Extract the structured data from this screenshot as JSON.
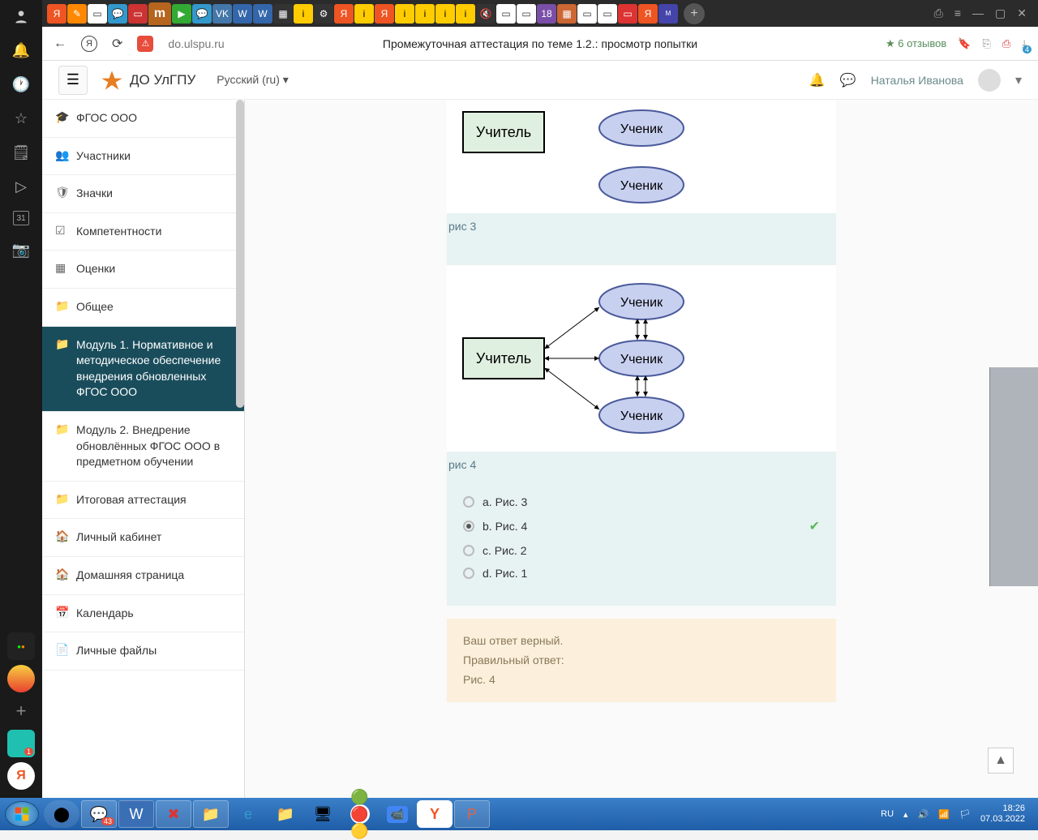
{
  "os_sidebar": {
    "icons": [
      "user",
      "bell",
      "clock",
      "star",
      "note",
      "play",
      "calendar",
      "camera"
    ]
  },
  "tabstrip": {
    "active": "m"
  },
  "addr": {
    "url": "do.ulspu.ru",
    "title": "Промежуточная аттестация по теме 1.2.: просмотр попытки",
    "reviews": "★ 6 отзывов",
    "download_badge": "4"
  },
  "moodle": {
    "brand": "ДО УлГПУ",
    "lang": "Русский (ru) ▾",
    "user": "Наталья Иванова"
  },
  "nav": [
    {
      "icon": "🎓",
      "label": "ФГОС ООО"
    },
    {
      "icon": "👥",
      "label": "Участники"
    },
    {
      "icon": "🛡",
      "label": "Значки"
    },
    {
      "icon": "☑",
      "label": "Компетентности"
    },
    {
      "icon": "▦",
      "label": "Оценки"
    },
    {
      "icon": "📁",
      "label": "Общее"
    },
    {
      "icon": "📁",
      "label": "Модуль 1. Нормативное и методическое обеспечение внедрения обновленных ФГОС ООО",
      "active": true
    },
    {
      "icon": "📁",
      "label": "Модуль 2. Внедрение обновлённых ФГОС ООО в предметном обучении"
    },
    {
      "icon": "📁",
      "label": "Итоговая аттестация"
    },
    {
      "icon": "🏠",
      "label": "Личный кабинет"
    },
    {
      "icon": "🏠",
      "label": "Домашняя страница"
    },
    {
      "icon": "📅",
      "label": "Календарь"
    },
    {
      "icon": "📄",
      "label": "Личные файлы"
    }
  ],
  "quiz": {
    "teacher": "Учитель",
    "pupil": "Ученик",
    "cap3": "рис 3",
    "cap4": "рис 4",
    "answers": [
      {
        "label": "a. Рис. 3",
        "selected": false,
        "correct": false
      },
      {
        "label": "b. Рис. 4",
        "selected": true,
        "correct": true
      },
      {
        "label": "c. Рис. 2",
        "selected": false,
        "correct": false
      },
      {
        "label": "d. Рис. 1",
        "selected": false,
        "correct": false
      }
    ],
    "fb_correct": "Ваш ответ верный.",
    "fb_right_label": "Правильный ответ:",
    "fb_right_value": "Рис. 4"
  },
  "tray": {
    "lang": "RU",
    "time": "18:26",
    "date": "07.03.2022"
  }
}
